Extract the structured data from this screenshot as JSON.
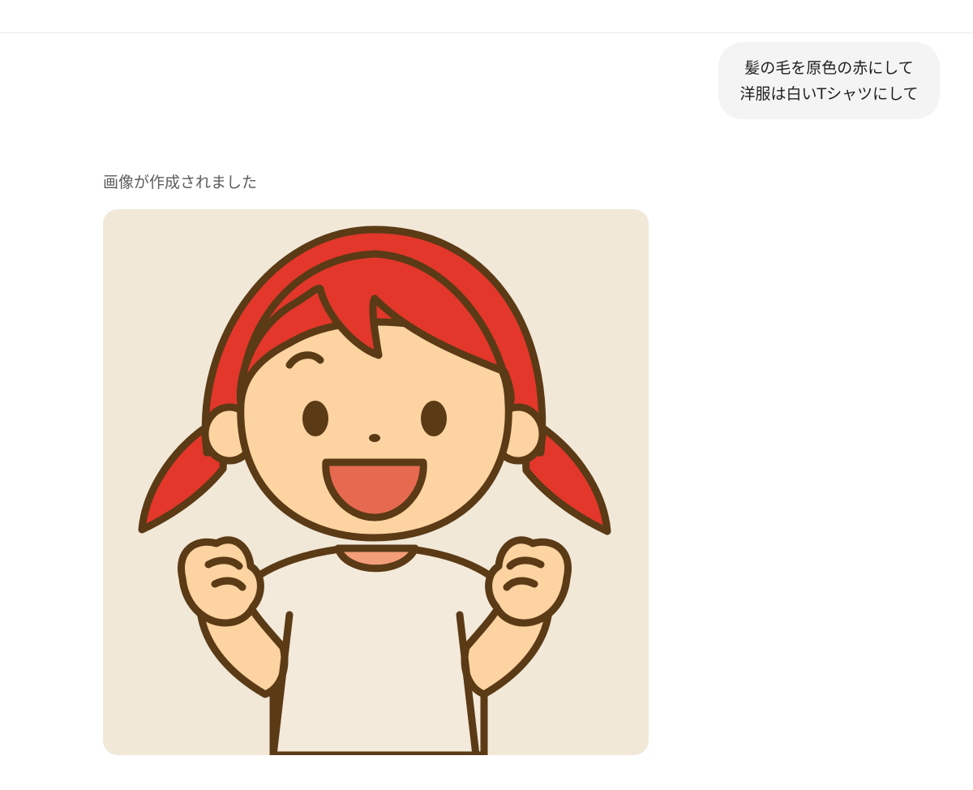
{
  "conversation": {
    "user_message": {
      "lines": [
        "髪の毛を原色の赤にして",
        "洋服は白いTシャツにして"
      ]
    },
    "assistant_message": {
      "status": "画像が作成されました",
      "image": {
        "subject": "smiling-girl-red-hair-white-tshirt-illustration",
        "colors": {
          "background": "#f1e8d8",
          "hair": "#e2372a",
          "skin": "#fcd3a1",
          "shirt": "#f3eadb",
          "mouth": "#e66a50",
          "collar": "#f29e79",
          "outline": "#5b3a16"
        }
      }
    }
  }
}
